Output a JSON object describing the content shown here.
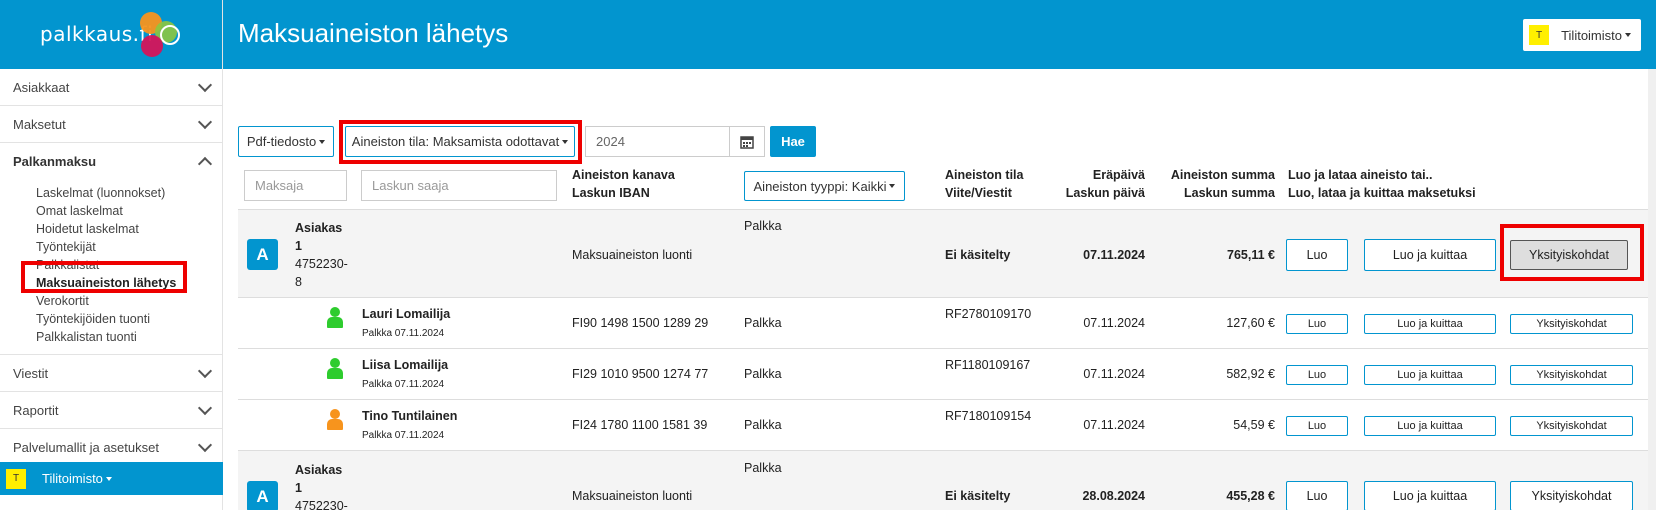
{
  "brand": {
    "name": "palkkaus.fi",
    "colors": {
      "primary": "#0295cf",
      "orange": "#f7941d",
      "green": "#8dc63f",
      "magenta": "#d4145a",
      "badge_yellow": "#ffef00",
      "highlight_red": "#e00000"
    }
  },
  "header": {
    "title": "Maksuaineiston lähetys"
  },
  "user": {
    "badge": "T",
    "label": "Tilitoimisto"
  },
  "sidebar": {
    "items_top": [
      {
        "label": "Asiakkaat"
      },
      {
        "label": "Maksetut"
      }
    ],
    "open_section": {
      "label": "Palkanmaksu",
      "subitems": [
        {
          "label": "Laskelmat (luonnokset)"
        },
        {
          "label": "Omat laskelmat"
        },
        {
          "label": "Hoidetut laskelmat"
        },
        {
          "label": "Työntekijät"
        },
        {
          "label": "Palkkalistat"
        },
        {
          "label": "Maksuaineiston lähetys",
          "active": true
        },
        {
          "label": "Verokortit"
        },
        {
          "label": "Työntekijöiden tuonti"
        },
        {
          "label": "Palkkalistan tuonti"
        }
      ]
    },
    "items_bottom": [
      {
        "label": "Viestit"
      },
      {
        "label": "Raportit"
      },
      {
        "label": "Palvelumallit ja asetukset"
      }
    ],
    "footer": {
      "badge": "T",
      "label": "Tilitoimisto"
    }
  },
  "toolbar": {
    "pdf_label": "Pdf-tiedosto",
    "status_filter_label": "Aineiston tila: Maksamista odottavat",
    "year_value": "2024",
    "search_label": "Hae"
  },
  "filters": {
    "payer_placeholder": "Maksaja",
    "recipient_placeholder": "Laskun saaja",
    "type_filter_label": "Aineiston tyyppi: Kaikki"
  },
  "columns": {
    "channel": [
      "Aineiston kanava",
      "Laskun IBAN"
    ],
    "status": [
      "Aineiston tila",
      "Viite/Viestit"
    ],
    "date": [
      "Eräpäivä",
      "Laskun päivä"
    ],
    "sum": [
      "Aineiston summa",
      "Laskun summa"
    ],
    "actions": [
      "Luo ja lataa aineisto tai..",
      "Luo, lataa ja kuittaa maksetuksi"
    ]
  },
  "actions": {
    "create": "Luo",
    "create_confirm": "Luo ja kuittaa",
    "details": "Yksityiskohdat"
  },
  "groups": [
    {
      "badge": "A",
      "customer_lines": [
        "Asiakas",
        "1",
        "4752230-",
        "8"
      ],
      "type": "Palkka",
      "channel": "Maksuaineiston luonti",
      "status": "Ei käsitelty",
      "due_date": "07.11.2024",
      "sum": "765,11 €",
      "employees": [
        {
          "name": "Lauri Lomailija",
          "sub": "Palkka 07.11.2024",
          "iban": "FI90 1498 1500 1289 29",
          "type": "Palkka",
          "ref": "RF2780109170",
          "date": "07.11.2024",
          "sum": "127,60 €",
          "color": "#2ecc2e"
        },
        {
          "name": "Liisa Lomailija",
          "sub": "Palkka 07.11.2024",
          "iban": "FI29 1010 9500 1274 77",
          "type": "Palkka",
          "ref": "RF1180109167",
          "date": "07.11.2024",
          "sum": "582,92 €",
          "color": "#2ecc2e"
        },
        {
          "name": "Tino Tuntilainen",
          "sub": "Palkka 07.11.2024",
          "iban": "FI24 1780 1100 1581 39",
          "type": "Palkka",
          "ref": "RF7180109154",
          "date": "07.11.2024",
          "sum": "54,59 €",
          "color": "#f7941d"
        }
      ]
    },
    {
      "badge": "A",
      "customer_lines": [
        "Asiakas",
        "1",
        "4752230-"
      ],
      "type": "Palkka",
      "channel": "Maksuaineiston luonti",
      "status": "Ei käsitelty",
      "due_date": "28.08.2024",
      "sum": "455,28 €"
    }
  ]
}
